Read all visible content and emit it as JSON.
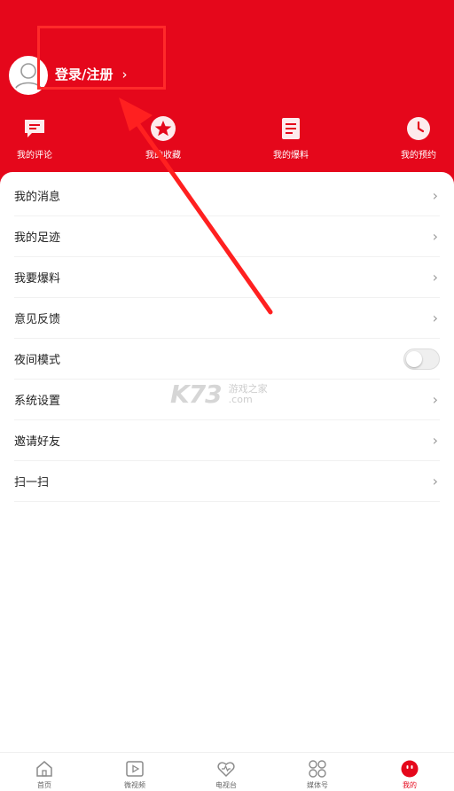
{
  "header": {
    "login_label": "登录/注册",
    "chevron": "›",
    "avatar_icon": "user-avatar-icon",
    "background_color": "#e5071b"
  },
  "quick_actions": [
    {
      "label": "我的评论",
      "icon": "comment-icon"
    },
    {
      "label": "我的收藏",
      "icon": "star-icon"
    },
    {
      "label": "我的爆料",
      "icon": "document-icon"
    },
    {
      "label": "我的预约",
      "icon": "clock-icon"
    }
  ],
  "menu": [
    {
      "label": "我的消息",
      "chevron": "›"
    },
    {
      "label": "我的足迹",
      "chevron": "›"
    },
    {
      "label": "我要爆料",
      "chevron": "›"
    },
    {
      "label": "意见反馈",
      "chevron": "›"
    },
    {
      "label": "夜间模式",
      "toggle": "off"
    },
    {
      "label": "系统设置",
      "chevron": "›"
    },
    {
      "label": "邀请好友",
      "chevron": "›"
    },
    {
      "label": "扫一扫",
      "chevron": "›"
    }
  ],
  "watermark": {
    "logo": "K73",
    "line1": "游戏之家",
    "line2": ".com"
  },
  "tabbar": [
    {
      "label": "首页",
      "icon": "home-icon"
    },
    {
      "label": "微视频",
      "icon": "video-icon"
    },
    {
      "label": "电视台",
      "icon": "tv-heart-icon"
    },
    {
      "label": "媒体号",
      "icon": "grid-icon"
    },
    {
      "label": "我的",
      "icon": "profile-icon",
      "active": true
    }
  ],
  "accent_color": "#e5071b"
}
